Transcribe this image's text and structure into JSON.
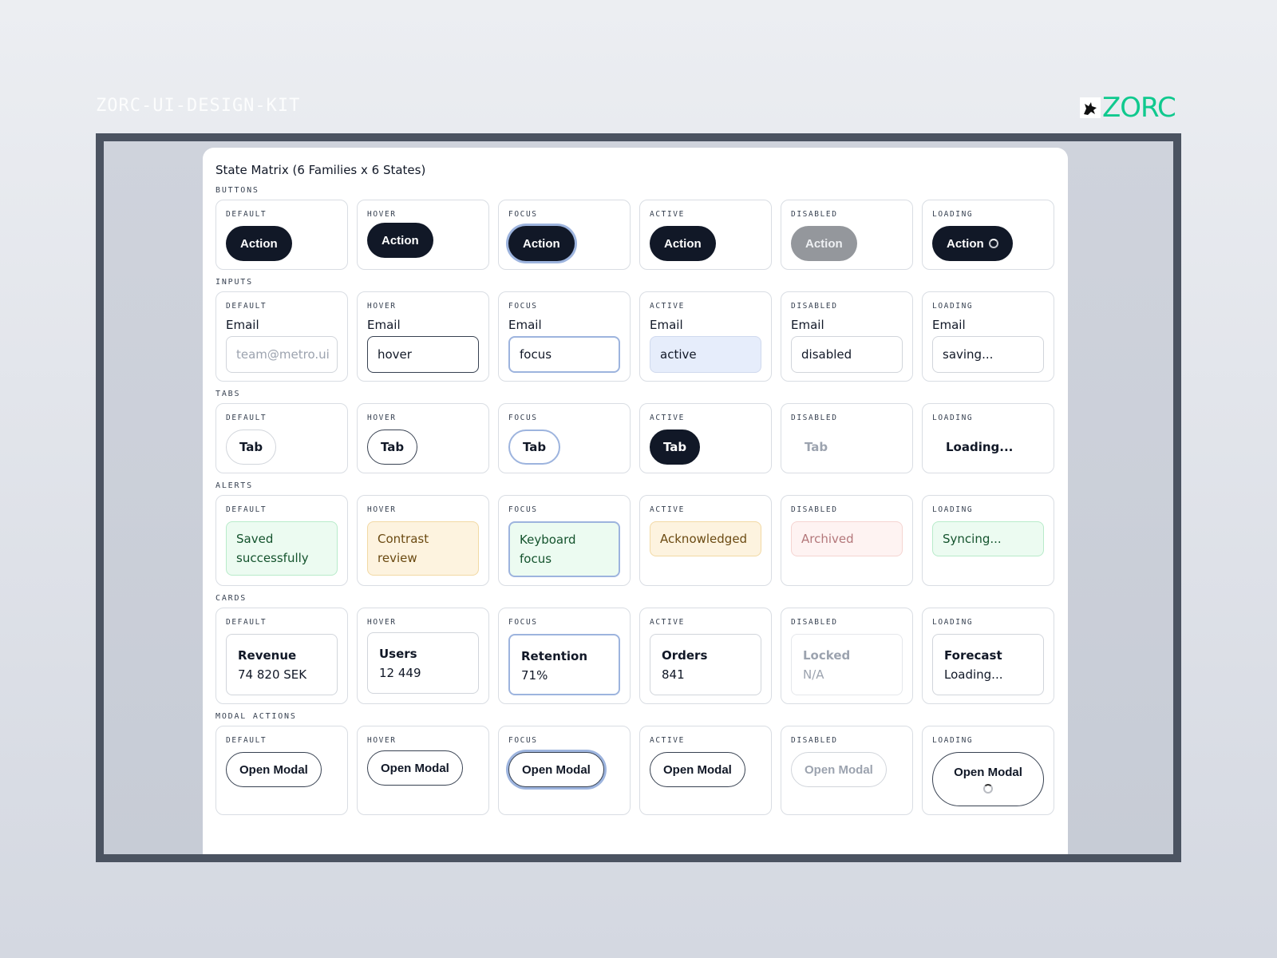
{
  "kit_title": "ZORC-UI-DESIGN-KIT",
  "brand": {
    "name": "ZORC",
    "accent": "#10c98e"
  },
  "panel_title": "State Matrix (6 Families x 6 States)",
  "states": [
    "DEFAULT",
    "HOVER",
    "FOCUS",
    "ACTIVE",
    "DISABLED",
    "LOADING"
  ],
  "buttons": {
    "label": "BUTTONS",
    "action_label": "Action"
  },
  "inputs": {
    "label": "INPUTS",
    "field_label": "Email",
    "placeholder": "team@metro.ui",
    "values": [
      "",
      "hover",
      "focus",
      "active",
      "disabled",
      "saving..."
    ]
  },
  "tabs": {
    "label": "TABS",
    "tab_label": "Tab",
    "loading_label": "Loading..."
  },
  "alerts": {
    "label": "ALERTS",
    "messages": [
      "Saved successfully",
      "Contrast review",
      "Keyboard focus",
      "Acknowledged",
      "Archived",
      "Syncing..."
    ]
  },
  "cards": {
    "label": "CARDS",
    "items": [
      {
        "title": "Revenue",
        "value": "74 820 SEK"
      },
      {
        "title": "Users",
        "value": "12 449"
      },
      {
        "title": "Retention",
        "value": "71%"
      },
      {
        "title": "Orders",
        "value": "841"
      },
      {
        "title": "Locked",
        "value": "N/A"
      },
      {
        "title": "Forecast",
        "value": "Loading..."
      }
    ]
  },
  "modal_actions": {
    "label": "MODAL ACTIONS",
    "button_label": "Open Modal"
  }
}
